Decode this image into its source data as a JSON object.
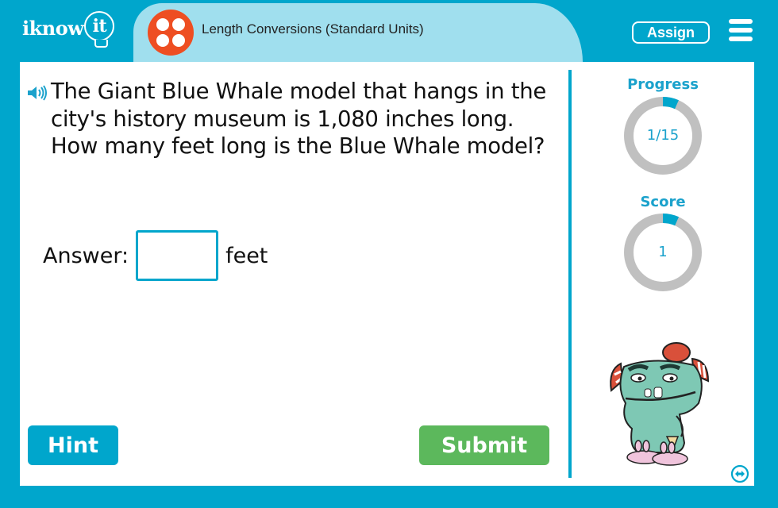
{
  "header": {
    "logo_text_main": "iknow",
    "logo_text_bulb": "it",
    "activity_icon": "four-dots-icon",
    "activity_title": "Length Conversions (Standard Units)",
    "assign_label": "Assign",
    "menu_icon": "hamburger-menu-icon"
  },
  "question": {
    "audio_icon": "speaker-icon",
    "text": "The Giant Blue Whale model that hangs in the city's history museum is 1,080 inches long. How many feet long is the Blue Whale model?"
  },
  "answer": {
    "label": "Answer:",
    "value": "",
    "placeholder": "",
    "unit": "feet"
  },
  "buttons": {
    "hint_label": "Hint",
    "submit_label": "Submit"
  },
  "sidebar": {
    "progress": {
      "label": "Progress",
      "display": "1/15",
      "current": 1,
      "total": 15
    },
    "score": {
      "label": "Score",
      "display": "1",
      "fraction": 0.067
    },
    "swap_icon": "swap-arrows-icon"
  },
  "colors": {
    "brand_blue": "#00a6cc",
    "tab_light_blue": "#a0dfee",
    "activity_orange": "#ee4e22",
    "submit_green": "#5cb85c",
    "ring_gray": "#c0c0c0",
    "label_blue": "#1ba2cc"
  }
}
